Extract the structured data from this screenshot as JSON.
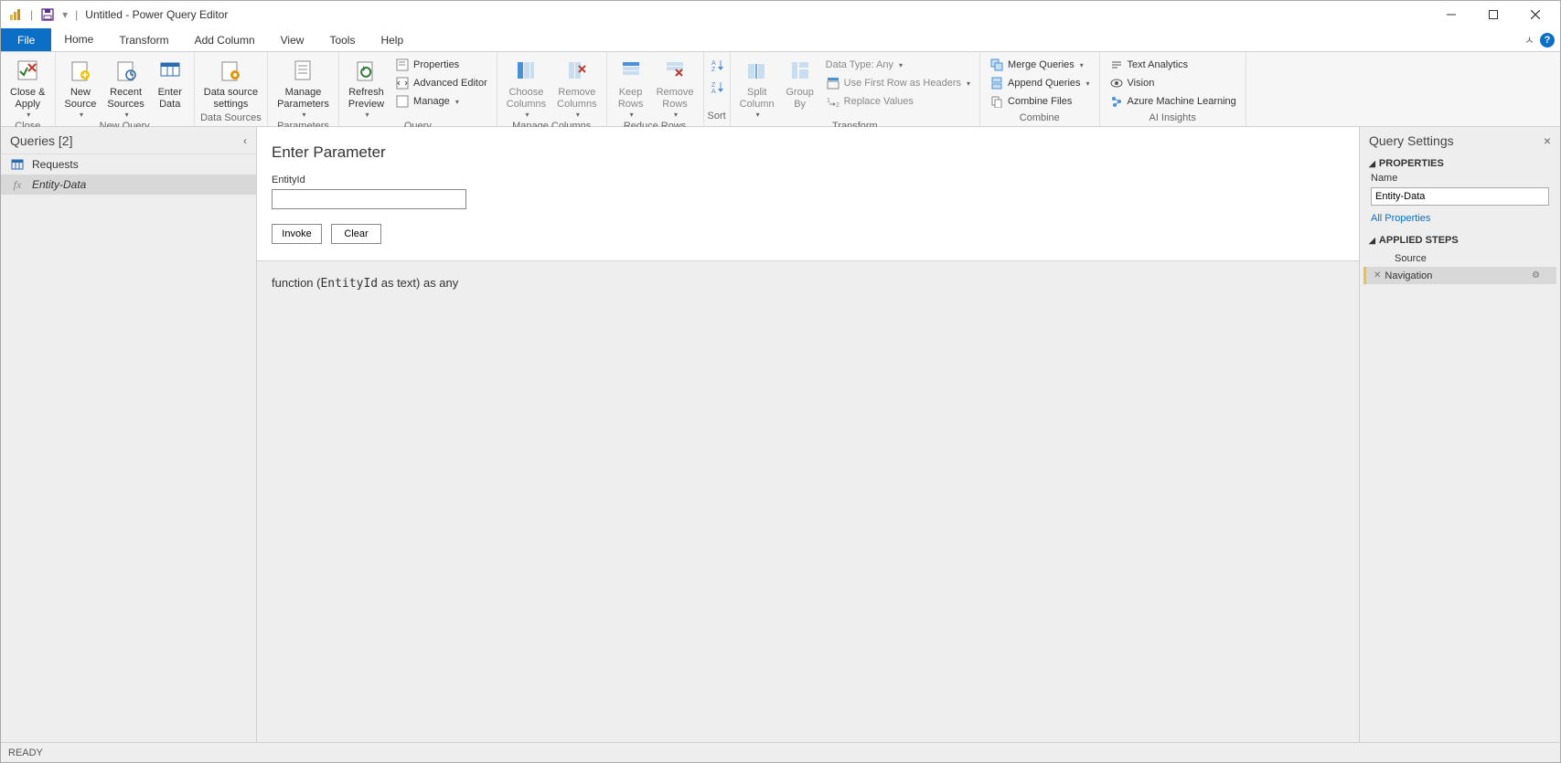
{
  "title": "Untitled - Power Query Editor",
  "tabs": {
    "file": "File",
    "home": "Home",
    "transform": "Transform",
    "addcolumn": "Add Column",
    "view": "View",
    "tools": "Tools",
    "help": "Help"
  },
  "ribbon": {
    "close": {
      "closeApply": "Close &\nApply",
      "group": "Close"
    },
    "newquery": {
      "newSource": "New\nSource",
      "recentSources": "Recent\nSources",
      "enterData": "Enter\nData",
      "group": "New Query"
    },
    "datasources": {
      "dss": "Data source\nsettings",
      "group": "Data Sources"
    },
    "parameters": {
      "manage": "Manage\nParameters",
      "group": "Parameters"
    },
    "query": {
      "refresh": "Refresh\nPreview",
      "properties": "Properties",
      "advEditor": "Advanced Editor",
      "manage": "Manage",
      "group": "Query"
    },
    "managecols": {
      "choose": "Choose\nColumns",
      "remove": "Remove\nColumns",
      "group": "Manage Columns"
    },
    "reducerows": {
      "keep": "Keep\nRows",
      "remove": "Remove\nRows",
      "group": "Reduce Rows"
    },
    "sort": {
      "group": "Sort"
    },
    "transform": {
      "split": "Split\nColumn",
      "groupby": "Group\nBy",
      "datatype": "Data Type: Any",
      "firstrow": "Use First Row as Headers",
      "replace": "Replace Values",
      "group": "Transform"
    },
    "combine": {
      "merge": "Merge Queries",
      "append": "Append Queries",
      "combinefiles": "Combine Files",
      "group": "Combine"
    },
    "ai": {
      "text": "Text Analytics",
      "vision": "Vision",
      "azure": "Azure Machine Learning",
      "group": "AI Insights"
    }
  },
  "queries": {
    "header": "Queries [2]",
    "items": [
      {
        "name": "Requests",
        "type": "table"
      },
      {
        "name": "Entity-Data",
        "type": "fx"
      }
    ]
  },
  "main": {
    "heading": "Enter Parameter",
    "paramLabel": "EntityId",
    "invoke": "Invoke",
    "clear": "Clear",
    "sig_pre": "function (",
    "sig_param": "EntityId",
    "sig_post": " as text) as any"
  },
  "settings": {
    "header": "Query Settings",
    "propsHeader": "PROPERTIES",
    "nameLabel": "Name",
    "nameValue": "Entity-Data",
    "allProps": "All Properties",
    "stepsHeader": "APPLIED STEPS",
    "steps": [
      {
        "name": "Source"
      },
      {
        "name": "Navigation"
      }
    ]
  },
  "status": "READY"
}
